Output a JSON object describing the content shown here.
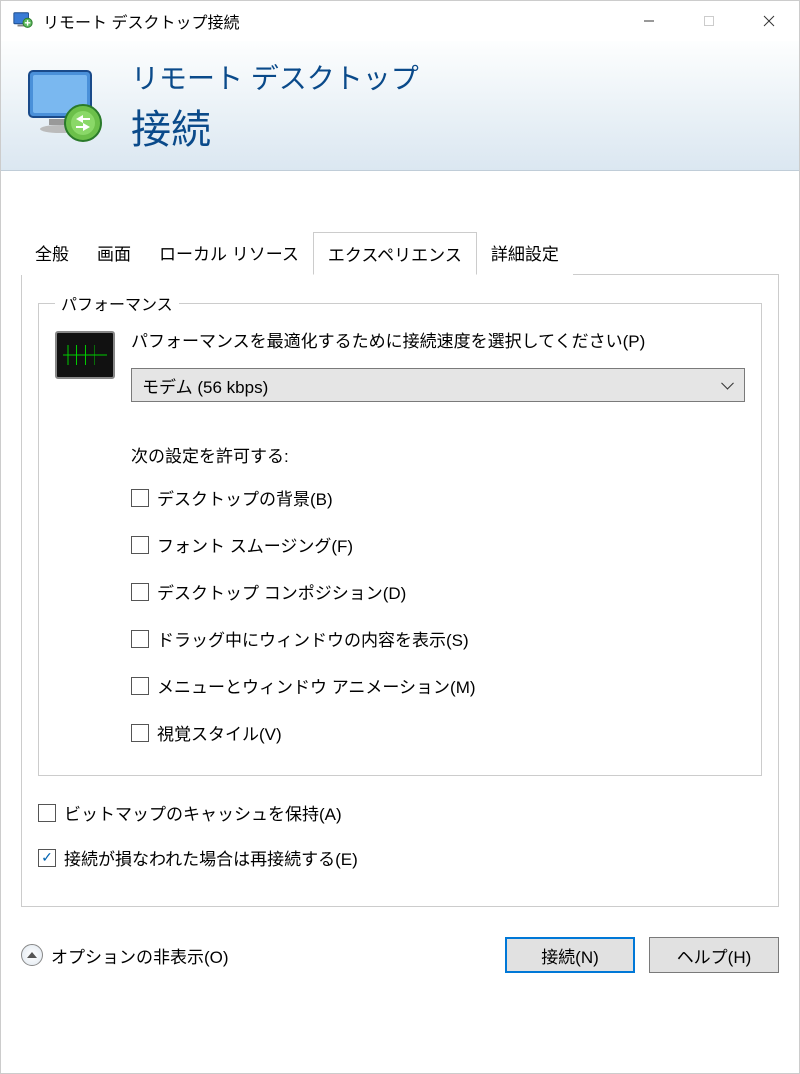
{
  "titlebar": {
    "title": "リモート デスクトップ接続"
  },
  "header": {
    "line1": "リモート デスクトップ",
    "line2": "接続"
  },
  "tabs": [
    {
      "label": "全般"
    },
    {
      "label": "画面"
    },
    {
      "label": "ローカル リソース"
    },
    {
      "label": "エクスペリエンス"
    },
    {
      "label": "詳細設定"
    }
  ],
  "performance": {
    "legend": "パフォーマンス",
    "instruction": "パフォーマンスを最適化するために接続速度を選択してください(P)",
    "selected": "モデム (56 kbps)",
    "allow_label": "次の設定を許可する:",
    "options": [
      {
        "label": "デスクトップの背景(B)",
        "checked": false
      },
      {
        "label": "フォント スムージング(F)",
        "checked": false
      },
      {
        "label": "デスクトップ コンポジション(D)",
        "checked": false
      },
      {
        "label": "ドラッグ中にウィンドウの内容を表示(S)",
        "checked": false
      },
      {
        "label": "メニューとウィンドウ アニメーション(M)",
        "checked": false
      },
      {
        "label": "視覚スタイル(V)",
        "checked": false
      }
    ]
  },
  "bottom_checks": [
    {
      "label": "ビットマップのキャッシュを保持(A)",
      "checked": false
    },
    {
      "label": "接続が損なわれた場合は再接続する(E)",
      "checked": true
    }
  ],
  "footer": {
    "options_toggle": "オプションの非表示(O)",
    "connect": "接続(N)",
    "help": "ヘルプ(H)"
  }
}
